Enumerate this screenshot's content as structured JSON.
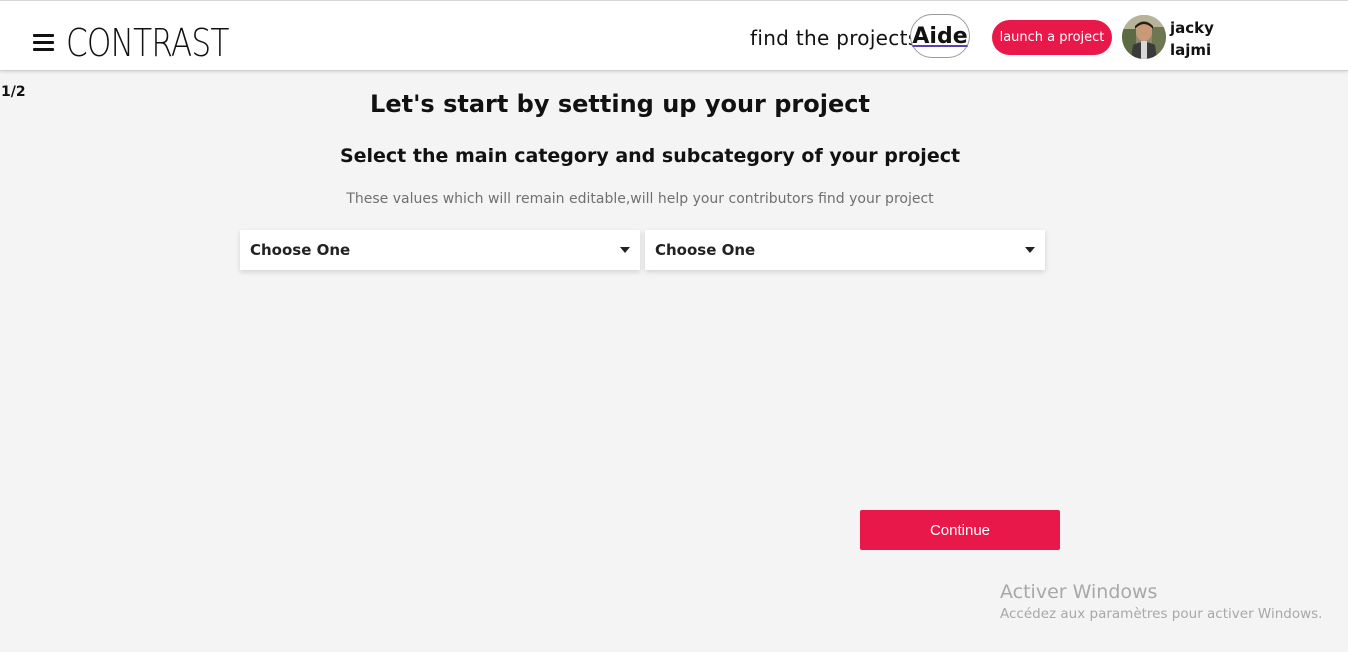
{
  "header": {
    "menu_icon": "hamburger-menu-icon",
    "logo_text": "CONTRAST",
    "find_projects_label": "find the projects",
    "aide_label": "Aide",
    "launch_button_label": "launch a project",
    "user": {
      "first_name": "jacky",
      "last_name": "lajmi"
    }
  },
  "main": {
    "step_counter": "1/2",
    "title": "Let's start by setting up your project",
    "subtitle": "Select the main category and subcategory of your project",
    "helper_text": "These values which will remain editable,will help your contributors find your project",
    "category_select": {
      "value": "Choose One"
    },
    "subcategory_select": {
      "value": "Choose One"
    },
    "continue_button_label": "Continue"
  },
  "watermark": {
    "title": "Activer Windows",
    "subtitle": "Accédez aux paramètres pour activer Windows."
  },
  "colors": {
    "accent": "#e8194a",
    "background": "#f4f4f4",
    "header_background": "#ffffff",
    "helper_text": "#707070"
  }
}
